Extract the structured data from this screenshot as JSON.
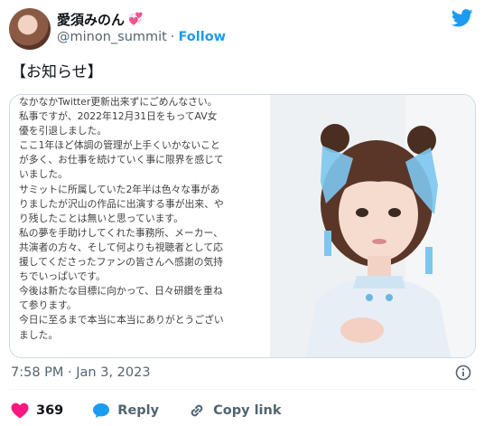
{
  "author": {
    "display_name": "愛須みのん",
    "display_emoji": "💞",
    "handle": "@minon_summit",
    "separator": "·",
    "follow_label": "Follow"
  },
  "tweet": {
    "text": "【お知らせ】",
    "timestamp": "7:58 PM · Jan 3, 2023"
  },
  "letter_lines": [
    "なかなかTwitter更新出来ずにごめんなさい。",
    "私事ですが、2022年12月31日をもってAV女",
    "優を引退しました。",
    "ここ1年ほど体調の管理が上手くいかないこと",
    "が多く、お仕事を続けていく事に限界を感じて",
    "いました。",
    "サミットに所属していた2年半は色々な事があ",
    "りましたが沢山の作品に出演する事が出来、や",
    "り残したことは無いと思っています。",
    "私の夢を手助けしてくれた事務所、メーカー、",
    "共演者の方々、そして何よりも視聴者として応",
    "援してくださったファンの皆さんへ感謝の気持",
    "ちでいっぱいです。",
    "今後は新たな目標に向かって、日々研鑽を重ね",
    "て参ります。",
    "今日に至るまで本当に本当にありがとうござい",
    "ました。"
  ],
  "actions": {
    "like_count": "369",
    "reply_label": "Reply",
    "copy_link_label": "Copy link"
  },
  "colors": {
    "accent": "#1d9bf0",
    "like": "#f91880",
    "text": "#0f1419",
    "muted": "#536471"
  }
}
